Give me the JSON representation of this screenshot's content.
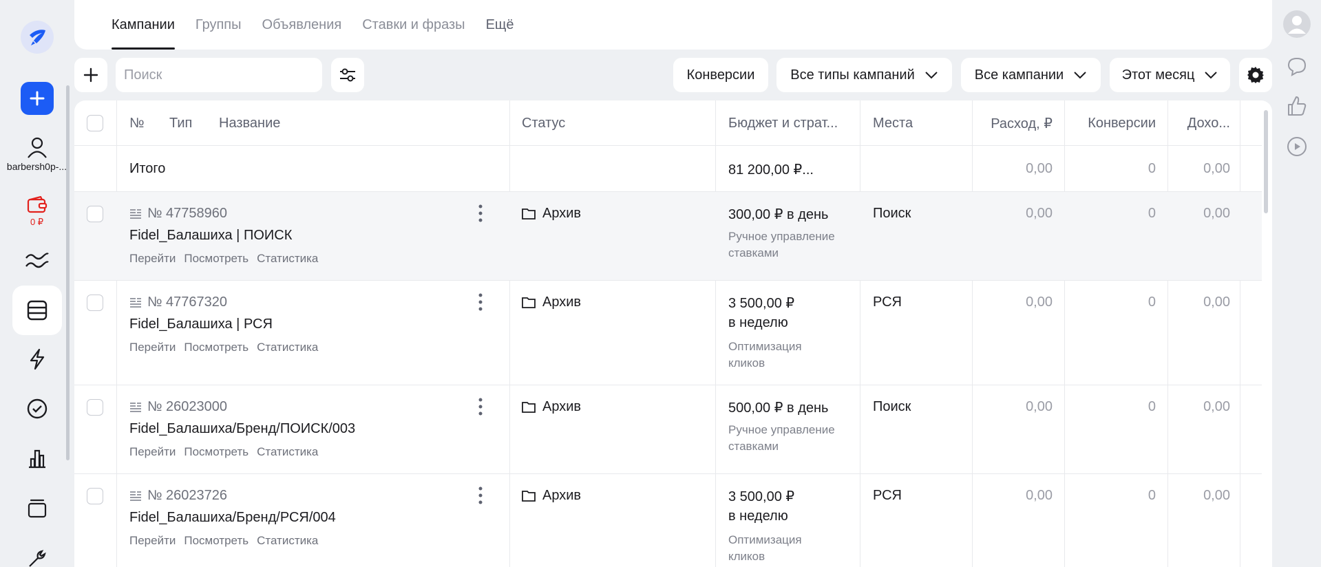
{
  "sidebar": {
    "account_name": "barbersh0p-...",
    "wallet_amount": "0 ₽"
  },
  "tabs": [
    {
      "label": "Кампании",
      "active": true
    },
    {
      "label": "Группы"
    },
    {
      "label": "Объявления"
    },
    {
      "label": "Ставки и фразы"
    },
    {
      "label": "Ещё"
    }
  ],
  "toolbar": {
    "search_placeholder": "Поиск",
    "conversions_label": "Конверсии",
    "campaign_types_label": "Все типы кампаний",
    "campaigns_label": "Все кампании",
    "period_label": "Этот месяц"
  },
  "table": {
    "headers": {
      "num": "№",
      "type": "Тип",
      "name": "Название",
      "status": "Статус",
      "budget": "Бюджет и страт...",
      "places": "Места",
      "spend": "Расход, ₽",
      "conversions": "Конверсии",
      "income": "Дохо..."
    },
    "totals": {
      "label": "Итого",
      "budget": "81 200,00 ₽...",
      "spend": "0,00",
      "conversions": "0",
      "income": "0,00"
    },
    "link_labels": [
      "Перейти",
      "Посмотреть",
      "Статистика"
    ],
    "rows": [
      {
        "id": "№ 47758960",
        "name": "Fidel_Балашиха | ПОИСК",
        "status": "Архив",
        "budget_line1": "300,00 ₽ в день",
        "budget_line2": "",
        "strategy_line1": "Ручное управление",
        "strategy_line2": "ставками",
        "place": "Поиск",
        "spend": "0,00",
        "conversions": "0",
        "income": "0,00"
      },
      {
        "id": "№ 47767320",
        "name": "Fidel_Балашиха | РСЯ",
        "status": "Архив",
        "budget_line1": "3 500,00 ₽",
        "budget_line2": "в неделю",
        "strategy_line1": "Оптимизация",
        "strategy_line2": "кликов",
        "place": "РСЯ",
        "spend": "0,00",
        "conversions": "0",
        "income": "0,00"
      },
      {
        "id": "№ 26023000",
        "name": "Fidel_Балашиха/Бренд/ПОИСК/003",
        "status": "Архив",
        "budget_line1": "500,00 ₽ в день",
        "budget_line2": "",
        "strategy_line1": "Ручное управление",
        "strategy_line2": "ставками",
        "place": "Поиск",
        "spend": "0,00",
        "conversions": "0",
        "income": "0,00"
      },
      {
        "id": "№ 26023726",
        "name": "Fidel_Балашиха/Бренд/РСЯ/004",
        "status": "Архив",
        "budget_line1": "3 500,00 ₽",
        "budget_line2": "в неделю",
        "strategy_line1": "Оптимизация",
        "strategy_line2": "кликов",
        "place": "РСЯ",
        "spend": "0,00",
        "conversions": "0",
        "income": "0,00"
      }
    ]
  },
  "colors": {
    "accent": "#1c5cf5",
    "warning": "#e2211c",
    "background": "#eef0f3"
  }
}
